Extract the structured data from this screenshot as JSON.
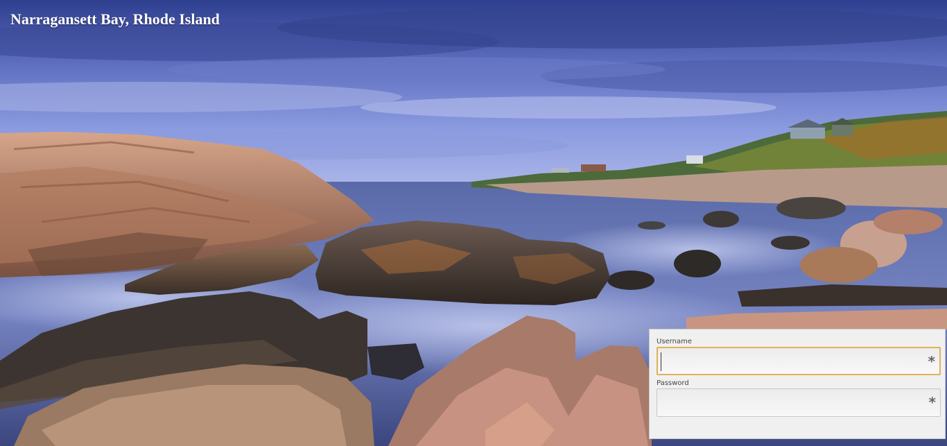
{
  "page": {
    "caption": "Narragansett Bay, Rhode Island"
  },
  "login": {
    "username_label": "Username",
    "username_value": "",
    "password_label": "Password",
    "password_value": "",
    "required_marker": "*",
    "focus_color": "#e0b25a"
  },
  "icons": {
    "required": "asterisk-icon"
  }
}
